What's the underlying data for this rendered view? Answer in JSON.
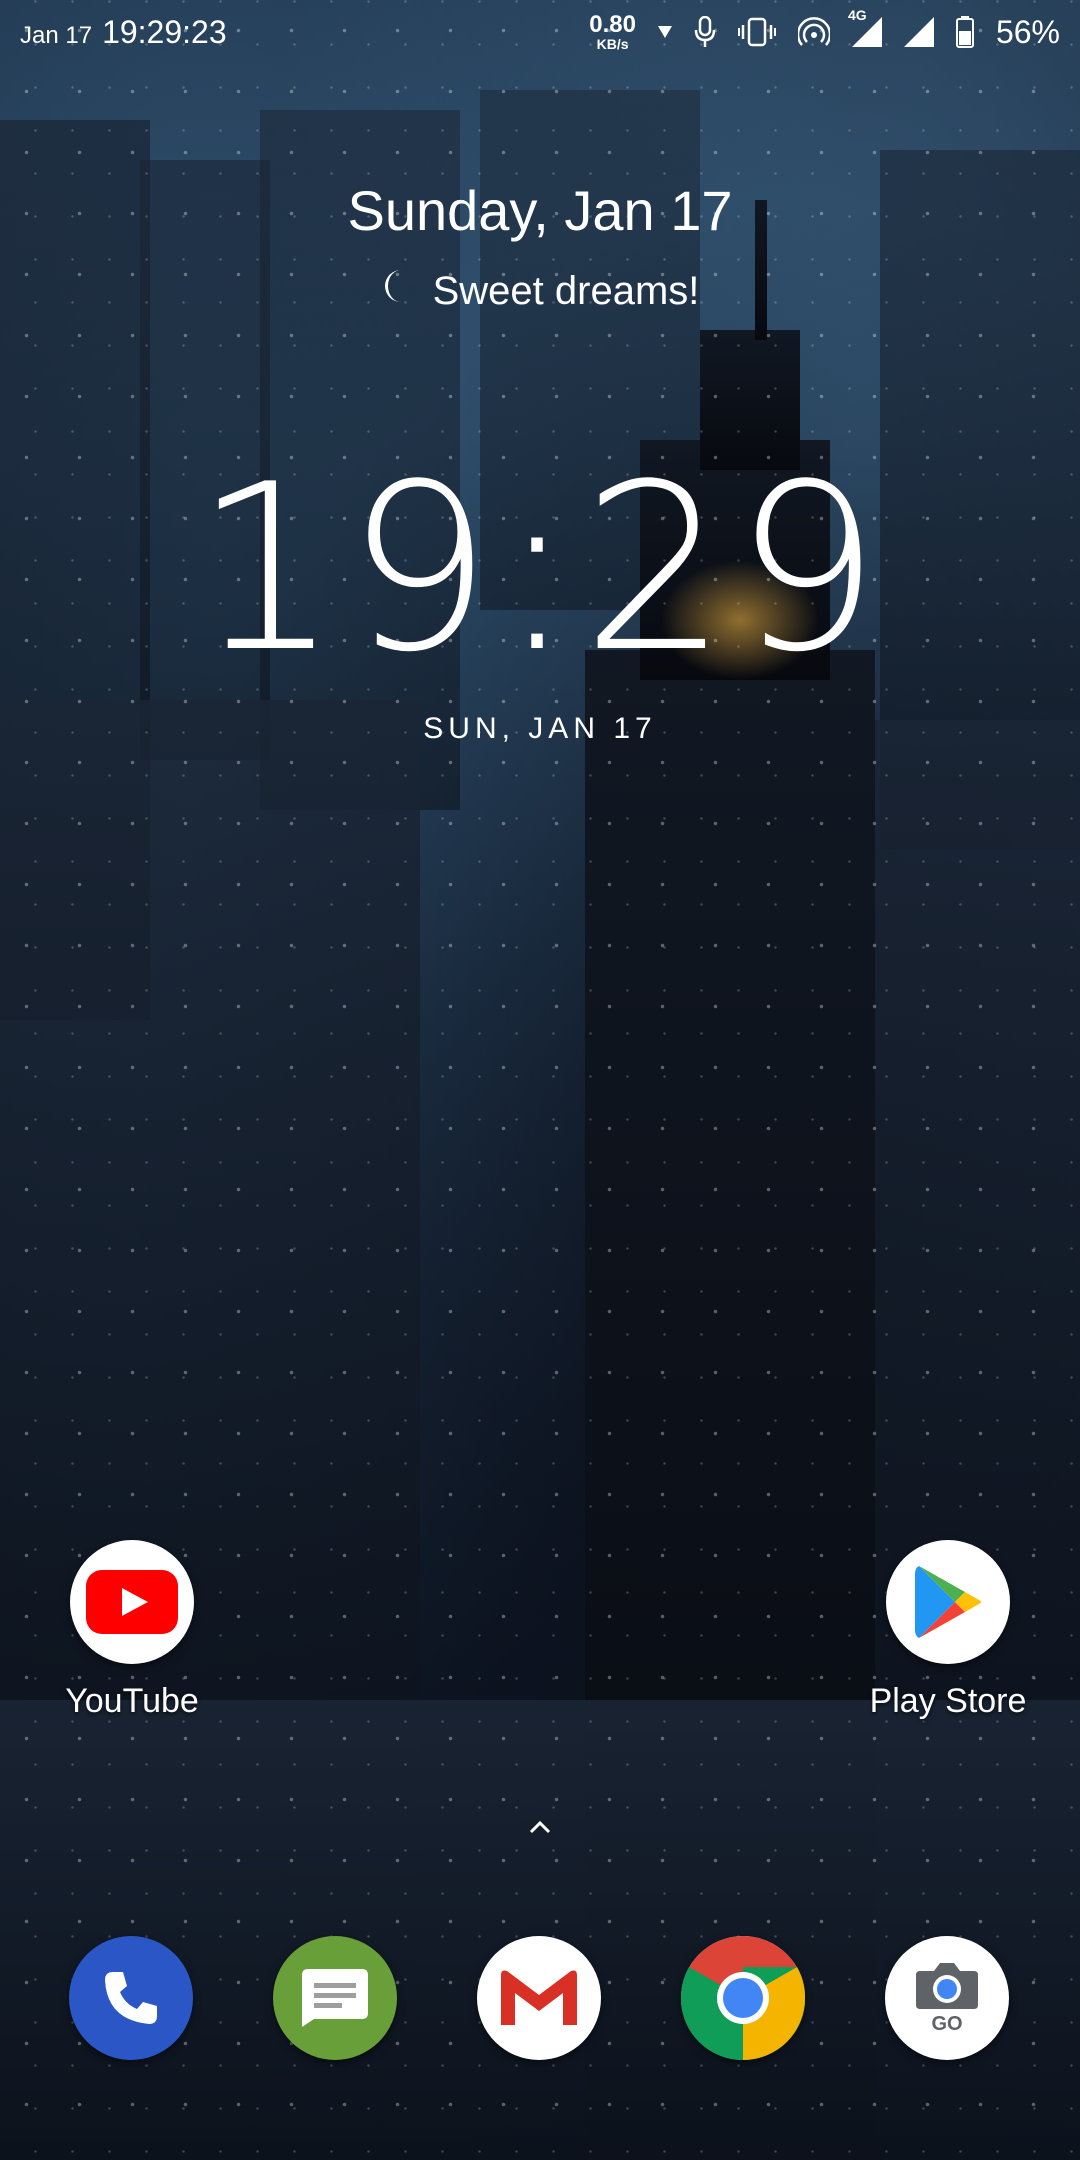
{
  "status_bar": {
    "date": "Jan 17",
    "time": "19:29:23",
    "net_speed": "0.80",
    "net_unit": "KB/s",
    "network_type": "4G",
    "battery": "56%"
  },
  "glance": {
    "date": "Sunday, Jan 17",
    "greeting": "Sweet dreams!"
  },
  "clock": {
    "time": "19:29",
    "date": "SUN, JAN 17"
  },
  "home_apps": [
    {
      "label": "YouTube",
      "icon": "youtube-icon"
    },
    {
      "label": "Play Store",
      "icon": "play-store-icon"
    }
  ],
  "dock": [
    {
      "icon": "phone-icon"
    },
    {
      "icon": "messages-icon"
    },
    {
      "icon": "gmail-icon"
    },
    {
      "icon": "chrome-icon"
    },
    {
      "icon": "camera-go-icon",
      "badge": "GO"
    }
  ],
  "colors": {
    "youtube_red": "#FF0000",
    "phone_blue": "#2A56C6",
    "messages_green": "#689F38",
    "gmail_red": "#D93025"
  }
}
